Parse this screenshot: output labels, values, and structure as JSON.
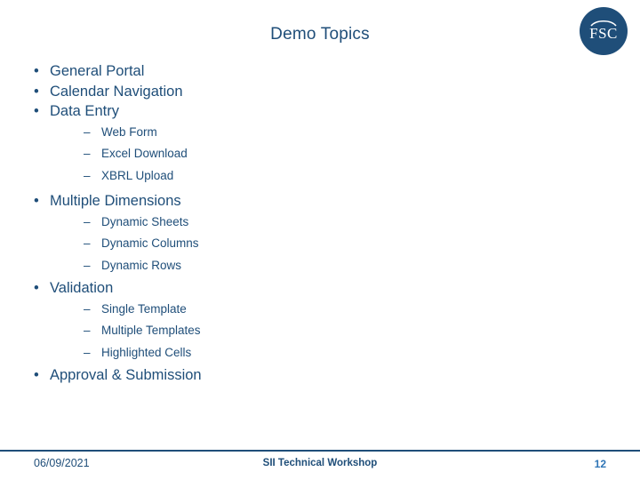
{
  "slide": {
    "title": "Demo Topics",
    "logo": {
      "name": "fsc-logo",
      "text": "FSC"
    },
    "items": [
      {
        "label": "General Portal",
        "sub": []
      },
      {
        "label": "Calendar Navigation",
        "sub": []
      },
      {
        "label": "Data Entry",
        "sub": [
          "Web Form",
          "Excel Download",
          "XBRL Upload"
        ]
      },
      {
        "label": "Multiple Dimensions",
        "sub": [
          "Dynamic Sheets",
          "Dynamic Columns",
          "Dynamic Rows"
        ]
      },
      {
        "label": "Validation",
        "sub": [
          "Single Template",
          "Multiple Templates",
          "Highlighted Cells"
        ]
      },
      {
        "label": "Approval & Submission",
        "sub": []
      }
    ],
    "bullet_glyph": "•",
    "dash_glyph": "–"
  },
  "footer": {
    "date": "06/09/2021",
    "center": "SII Technical Workshop",
    "page": "12"
  },
  "colors": {
    "primary": "#1f4e79",
    "accent": "#2e75b6"
  }
}
